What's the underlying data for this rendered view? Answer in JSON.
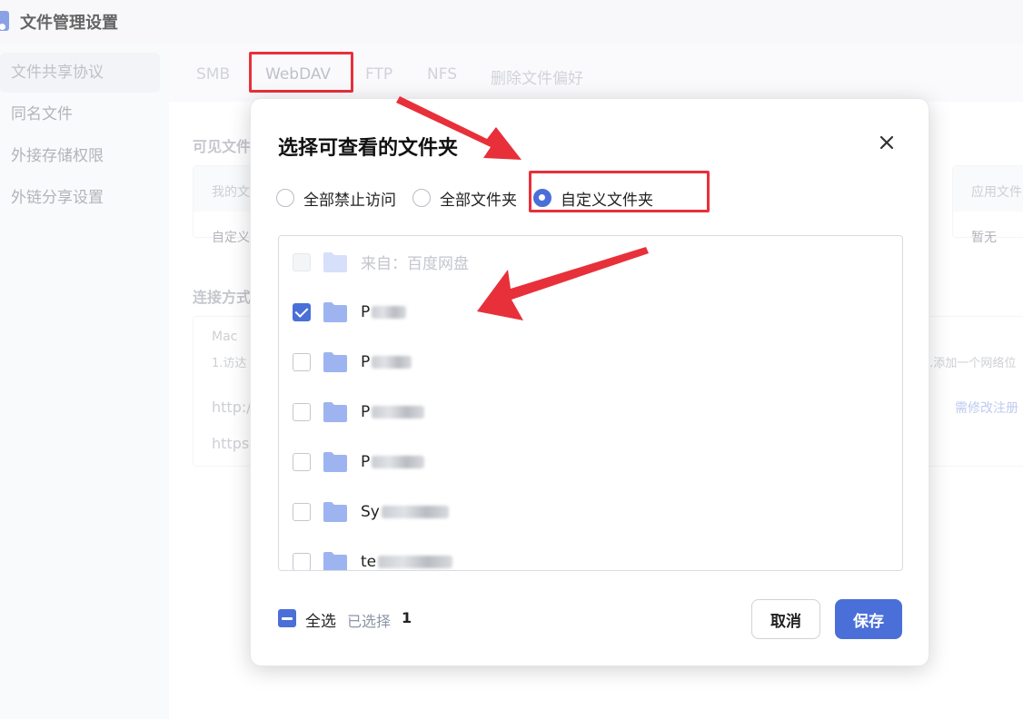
{
  "app": {
    "title": "文件管理设置"
  },
  "sidebar": {
    "items": [
      {
        "label": "文件共享协议"
      },
      {
        "label": "同名文件"
      },
      {
        "label": "外接存储权限"
      },
      {
        "label": "外链分享设置"
      }
    ]
  },
  "tabs": [
    {
      "label": "SMB"
    },
    {
      "label": "WebDAV"
    },
    {
      "label": "FTP"
    },
    {
      "label": "NFS"
    },
    {
      "label": "删除文件偏好"
    }
  ],
  "background": {
    "section1_title": "可见文件",
    "section2_title": "连接方式",
    "card1_head": "我的文",
    "card1_value": "自定义",
    "card2_head": "应用文件",
    "card2_value": "暂无",
    "mac_label": "Mac",
    "mac_step": "1.访达",
    "mac_step_right": "3.添加一个网络位",
    "http_label": "http:/",
    "https_label": "https:",
    "note_right": "需修改注册"
  },
  "dialog": {
    "title": "选择可查看的文件夹",
    "radio_options": [
      {
        "label": "全部禁止访问",
        "selected": false
      },
      {
        "label": "全部文件夹",
        "selected": false
      },
      {
        "label": "自定义文件夹",
        "selected": true
      }
    ],
    "folders": [
      {
        "name": "来自：百度网盘",
        "checked": false,
        "disabled": true
      },
      {
        "name": "P",
        "checked": true,
        "disabled": false
      },
      {
        "name": "P",
        "checked": false,
        "disabled": false
      },
      {
        "name": "P",
        "checked": false,
        "disabled": false
      },
      {
        "name": "P",
        "checked": false,
        "disabled": false
      },
      {
        "name": "Sy",
        "checked": false,
        "disabled": false
      },
      {
        "name": "te",
        "checked": false,
        "disabled": false
      }
    ],
    "select_all_label": "全选",
    "selected_label": "已选择",
    "selected_count": "1",
    "cancel_label": "取消",
    "save_label": "保存"
  },
  "colors": {
    "accent": "#4a6fd8",
    "annotation": "#e8303a",
    "folder": "#9db4f0"
  }
}
